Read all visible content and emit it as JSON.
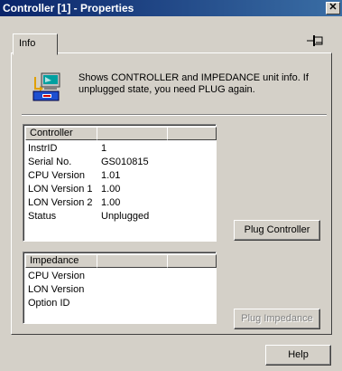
{
  "window": {
    "title": "Controller [1] - Properties",
    "close_glyph": "✕"
  },
  "tabs": [
    {
      "label": "Info"
    }
  ],
  "info": {
    "text": "Shows CONTROLLER and IMPEDANCE unit info.  If unplugged state, you need PLUG again.",
    "icon": "controller-info-icon"
  },
  "controller": {
    "header": "Controller",
    "rows": [
      {
        "key": "InstrID",
        "value": "1"
      },
      {
        "key": "Serial No.",
        "value": "GS010815"
      },
      {
        "key": "CPU Version",
        "value": "1.01"
      },
      {
        "key": "LON Version 1",
        "value": "1.00"
      },
      {
        "key": "LON Version 2",
        "value": "1.00"
      },
      {
        "key": "Status",
        "value": "Unplugged"
      }
    ]
  },
  "impedance": {
    "header": "Impedance",
    "rows": [
      {
        "key": "CPU Version",
        "value": ""
      },
      {
        "key": "LON Version",
        "value": ""
      },
      {
        "key": "Option ID",
        "value": ""
      }
    ]
  },
  "buttons": {
    "plug_controller": "Plug Controller",
    "plug_impedance": "Plug Impedance",
    "help": "Help"
  },
  "colors": {
    "titlebar_start": "#0a246a",
    "titlebar_end": "#3a6ea5",
    "face": "#d4d0c8"
  }
}
